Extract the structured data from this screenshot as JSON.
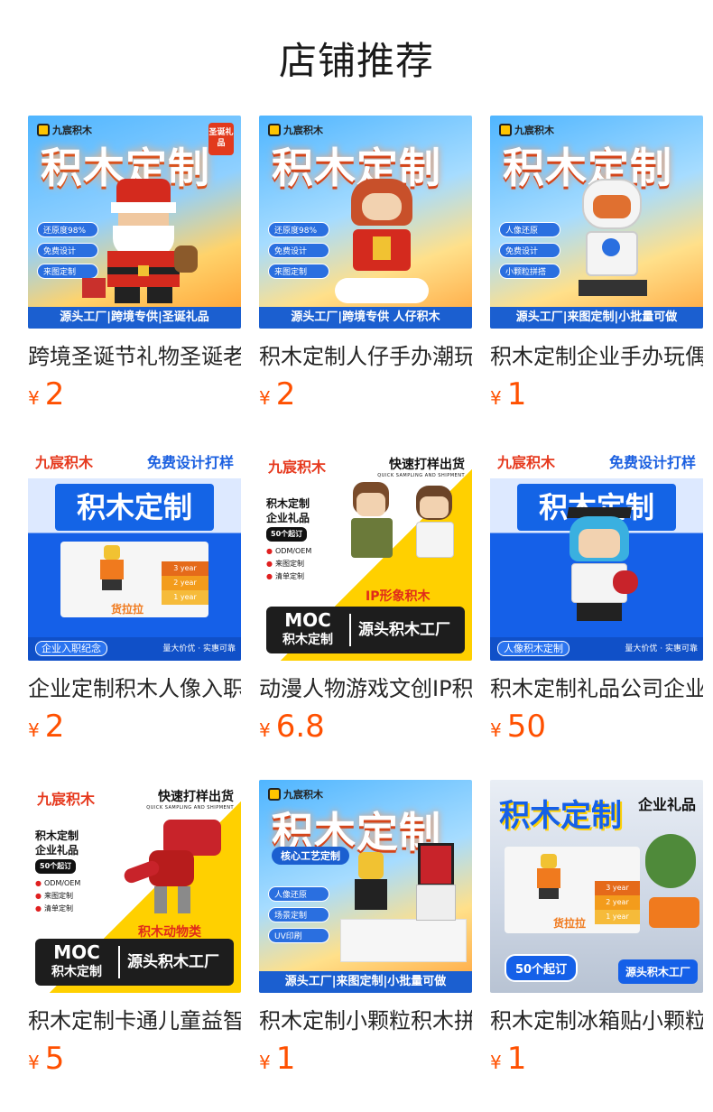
{
  "page": {
    "title": "店铺推荐"
  },
  "products": [
    {
      "title": "跨境圣诞节礼物圣诞老人积木",
      "price_symbol": "¥",
      "price": "2",
      "thumb": {
        "brand": "九宸积木",
        "headline": "积木定制",
        "corner_badge": "圣诞礼品",
        "chips": [
          "还原度98%",
          "免费设计",
          "来图定制"
        ],
        "strip": "源头工厂|跨境专供|圣诞礼品"
      }
    },
    {
      "title": "积木定制人仔手办潮玩",
      "price_symbol": "¥",
      "price": "2",
      "thumb": {
        "brand": "九宸积木",
        "headline": "积木定制",
        "chips": [
          "还原度98%",
          "免费设计",
          "来图定制"
        ],
        "strip": "源头工厂|跨境专供 人仔积木"
      }
    },
    {
      "title": "积木定制企业手办玩偶",
      "price_symbol": "¥",
      "price": "1",
      "thumb": {
        "brand": "九宸积木",
        "headline": "积木定制",
        "chips": [
          "人像还原",
          "免费设计",
          "小颗粒拼搭"
        ],
        "strip": "源头工厂|来图定制|小批量可做"
      }
    },
    {
      "title": "企业定制积木人像入职纪念",
      "price_symbol": "¥",
      "price": "2",
      "thumb": {
        "brand": "九宸积木",
        "slogan": "免费设计打样",
        "headline": "积木定制",
        "years": [
          "3 year",
          "2 year",
          "1 year"
        ],
        "company": "货拉拉",
        "bottom_left": "企业入职纪念",
        "bottom_right": "量大价优 · 实惠可靠"
      }
    },
    {
      "title": "动漫人物游戏文创IP积木",
      "price_symbol": "¥",
      "price": "6.8",
      "thumb": {
        "brand": "九宸积木",
        "slogan": "快速打样出货",
        "slogan_en": "QUICK SAMPLING AND SHIPMENT",
        "side_title": [
          "积木定制",
          "企业礼品"
        ],
        "side_tag": "50个起订",
        "side_points": [
          "ODM/OEM",
          "来图定制",
          "清单定制"
        ],
        "label": "IP形象积木",
        "moc_top": "MOC",
        "moc_bottom": "积木定制",
        "moc_right": "源头积木工厂"
      }
    },
    {
      "title": "积木定制礼品公司企业",
      "price_symbol": "¥",
      "price": "50",
      "thumb": {
        "brand": "九宸积木",
        "slogan": "免费设计打样",
        "headline": "积木定制",
        "bottom_left": "人像积木定制",
        "bottom_right": "量大价优 · 实惠可靠"
      }
    },
    {
      "title": "积木定制卡通儿童益智",
      "price_symbol": "¥",
      "price": "5",
      "thumb": {
        "brand": "九宸积木",
        "slogan": "快速打样出货",
        "slogan_en": "QUICK SAMPLING AND SHIPMENT",
        "side_title": [
          "积木定制",
          "企业礼品"
        ],
        "side_tag": "50个起订",
        "side_points": [
          "ODM/OEM",
          "来图定制",
          "清单定制"
        ],
        "label": "积木动物类",
        "moc_top": "MOC",
        "moc_bottom": "积木定制",
        "moc_right": "源头积木工厂"
      }
    },
    {
      "title": "积木定制小颗粒积木拼装",
      "price_symbol": "¥",
      "price": "1",
      "thumb": {
        "brand": "九宸积木",
        "headline": "积木定制",
        "sub_banner": "核心工艺定制",
        "chips": [
          "人像还原",
          "场景定制",
          "UV印刷"
        ],
        "strip": "源头工厂|来图定制|小批量可做"
      }
    },
    {
      "title": "积木定制冰箱贴小颗粒",
      "price_symbol": "¥",
      "price": "1",
      "thumb": {
        "headline": "积木定制",
        "slogan": "企业礼品",
        "years": [
          "3 year",
          "2 year",
          "1 year"
        ],
        "company": "货拉拉",
        "badge_left": "50个起订",
        "badge_right": "源头积木工厂"
      }
    }
  ],
  "colors": {
    "price": "#ff5000",
    "brand_blue": "#1b5fd0",
    "brand_orange": "#f7a21a"
  }
}
